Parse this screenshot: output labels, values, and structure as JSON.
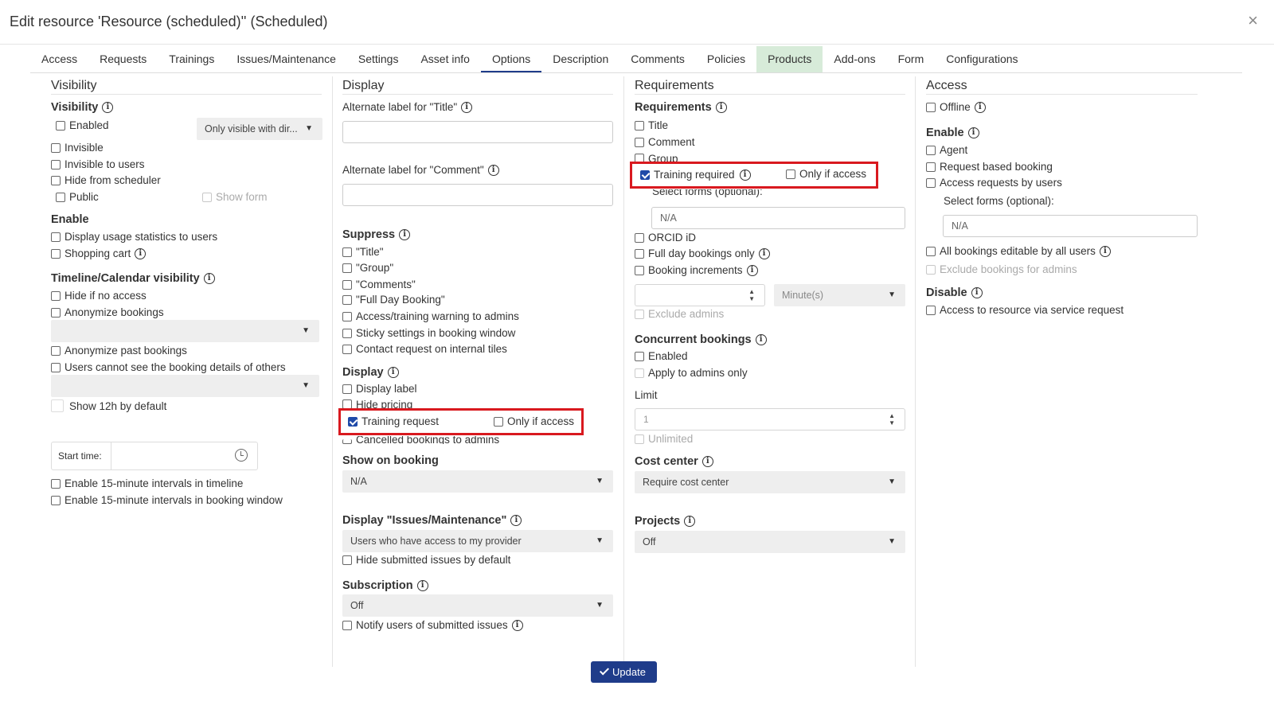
{
  "window": {
    "title": "Edit resource 'Resource (scheduled)'' (Scheduled)",
    "close": "×"
  },
  "tabs": [
    "Access",
    "Requests",
    "Trainings",
    "Issues/Maintenance",
    "Settings",
    "Asset info",
    "Options",
    "Description",
    "Comments",
    "Policies",
    "Products",
    "Add-ons",
    "Form",
    "Configurations"
  ],
  "active_tab": "Options",
  "visibility": {
    "heading": "Visibility",
    "visibility_label": "Visibility",
    "enabled": "Enabled",
    "mode_select": "Only visible with dir...",
    "invisible": "Invisible",
    "invisible_to_users": "Invisible to users",
    "hide_from_scheduler": "Hide from scheduler",
    "public": "Public",
    "show_form": "Show form",
    "enable_label": "Enable",
    "display_usage_statistics": "Display usage statistics to users",
    "shopping_cart": "Shopping cart",
    "timeline_label": "Timeline/Calendar visibility",
    "hide_if_no_access": "Hide if no access",
    "anonymize_bookings": "Anonymize bookings",
    "anonymize_past_bookings": "Anonymize past bookings",
    "users_cannot_see": "Users cannot see the booking details of others",
    "show_12h": "Show 12h by default",
    "start_time_label": "Start time:",
    "enable_15_timeline": "Enable 15-minute intervals in timeline",
    "enable_15_booking": "Enable 15-minute intervals in booking window"
  },
  "display": {
    "heading": "Display",
    "alt_title_label": "Alternate label for \"Title\"",
    "alt_comment_label": "Alternate label for \"Comment\"",
    "suppress_label": "Suppress",
    "suppress_title": "\"Title\"",
    "suppress_group": "\"Group\"",
    "suppress_comments": "\"Comments\"",
    "suppress_full_day": "\"Full Day Booking\"",
    "access_training_warning": "Access/training warning to admins",
    "sticky_settings": "Sticky settings in booking window",
    "contact_request": "Contact request on internal tiles",
    "display_label": "Display",
    "display_label_opt": "Display label",
    "hide_pricing": "Hide pricing",
    "training_request": "Training request",
    "only_if_access": "Only if access",
    "cancelled_bookings": "Cancelled bookings to admins",
    "show_on_booking_label": "Show on booking",
    "show_on_booking_value": "N/A",
    "display_issues_label": "Display \"Issues/Maintenance\"",
    "display_issues_value": "Users who have access to my provider",
    "hide_submitted_issues": "Hide submitted issues by default",
    "subscription_label": "Subscription",
    "subscription_value": "Off",
    "notify_users": "Notify users of submitted issues"
  },
  "requirements": {
    "heading": "Requirements",
    "requirements_label": "Requirements",
    "title": "Title",
    "comment": "Comment",
    "group": "Group",
    "training_required": "Training required",
    "only_if_access": "Only if access",
    "select_forms_label": "Select forms (optional):",
    "select_forms_value": "N/A",
    "orcid": "ORCID iD",
    "full_day_only": "Full day bookings only",
    "booking_increments": "Booking increments",
    "increment_unit": "Minute(s)",
    "exclude_admins": "Exclude admins",
    "concurrent_label": "Concurrent bookings",
    "concurrent_enabled": "Enabled",
    "apply_to_admins": "Apply to admins only",
    "limit_label": "Limit",
    "limit_value": "1",
    "unlimited": "Unlimited",
    "cost_center_label": "Cost center",
    "cost_center_value": "Require cost center",
    "projects_label": "Projects",
    "projects_value": "Off"
  },
  "access": {
    "heading": "Access",
    "offline": "Offline",
    "enable_label": "Enable",
    "agent": "Agent",
    "request_based_booking": "Request based booking",
    "access_requests_by_users": "Access requests by users",
    "select_forms_label": "Select forms (optional):",
    "select_forms_value": "N/A",
    "all_bookings_editable": "All bookings editable by all users",
    "exclude_bookings_for_admins": "Exclude bookings for admins",
    "disable_label": "Disable",
    "access_via_service_request": "Access to resource via service request"
  },
  "update_button": "Update",
  "icons": {
    "close": "close-icon",
    "info": "info-icon",
    "check": "check-icon",
    "clock": "clock-icon",
    "dropdown": "chevron-down-icon"
  },
  "colors": {
    "primary": "#1f3c8a",
    "highlight": "#d9191f",
    "products_tab": "#d7ebd9"
  }
}
